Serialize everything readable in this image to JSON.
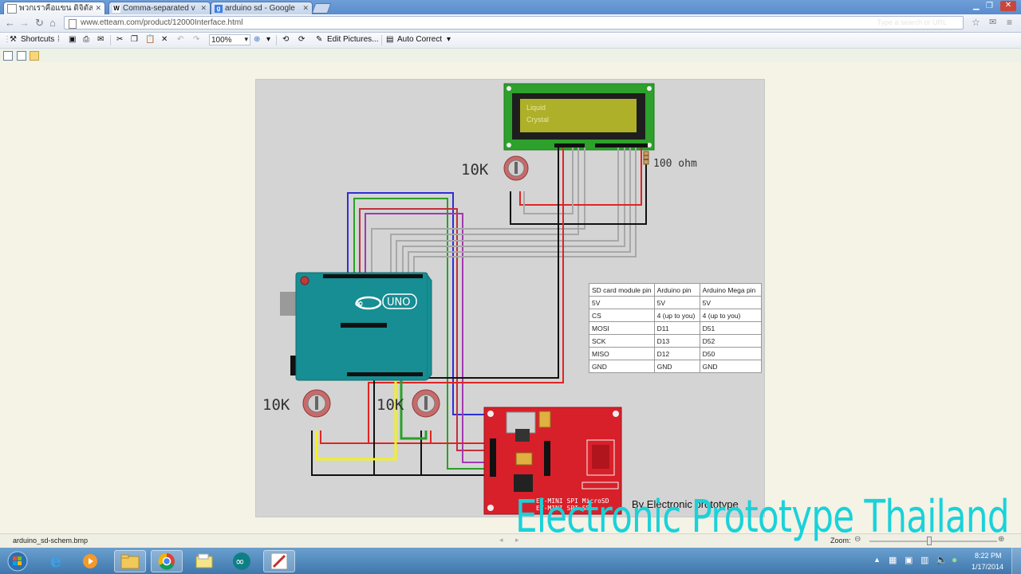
{
  "browser": {
    "tabs": [
      {
        "label": "พวกเราคือแขน ดิจิตัล",
        "icon": "page-icon",
        "active": true
      },
      {
        "label": "Comma-separated v",
        "icon": "wikipedia-icon",
        "active": false
      },
      {
        "label": "arduino sd - Google",
        "icon": "google-icon",
        "active": false
      }
    ],
    "url": "www.etteam.com/product/12000Interface.html",
    "omnibox_ghost": "Type a search or URL"
  },
  "viewer_toolbar": {
    "shortcuts_label": "Shortcuts",
    "zoom_value": "100%",
    "edit_pictures_label": "Edit Pictures...",
    "auto_correct_label": "Auto Correct"
  },
  "schematic": {
    "lcd_line1": "Liquid",
    "lcd_line2": "Crystal",
    "pot_top_label": "10K",
    "resistor_label": "100 ohm",
    "pot_left_label": "10K",
    "pot_right_label": "10K",
    "uno_label": "UNO",
    "sd_board_label1": "ET-MINI SPI MicroSD",
    "sd_board_label2": "ET-MINI SPI SD",
    "credit": "By Electronic prototype"
  },
  "pin_table": {
    "headers": [
      "SD card module pin",
      "Arduino pin",
      "Arduino Mega pin"
    ],
    "rows": [
      [
        "5V",
        "5V",
        "5V"
      ],
      [
        "CS",
        "4  (up to you)",
        "4  (up to you)"
      ],
      [
        "MOSI",
        "D11",
        "D51"
      ],
      [
        "SCK",
        "D13",
        "D52"
      ],
      [
        "MISO",
        "D12",
        "D50"
      ],
      [
        "GND",
        "GND",
        "GND"
      ]
    ]
  },
  "statusbar": {
    "filename": "arduino_sd-schem.bmp",
    "zoom_label": "Zoom:"
  },
  "watermark": "Electronic Prototype Thailand",
  "taskbar": {
    "time": "8:22 PM",
    "date": "1/17/2014",
    "apps": [
      "start-orb-icon",
      "ie-icon",
      "media-player-icon",
      "explorer-icon",
      "chrome-icon",
      "folder-icon",
      "arduino-icon",
      "paint-icon"
    ]
  },
  "colors": {
    "arduino_board": "#168e93",
    "sd_board": "#d8202a",
    "lcd_screen": "#aeb02a",
    "lcd_pcb": "#2da12b",
    "watermark": "#19d2d9"
  }
}
